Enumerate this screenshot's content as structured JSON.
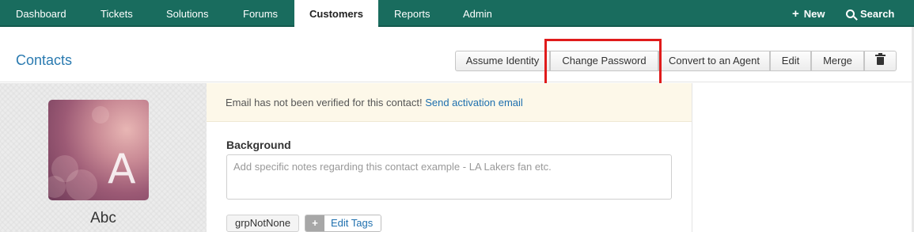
{
  "nav": {
    "items": [
      "Dashboard",
      "Tickets",
      "Solutions",
      "Forums",
      "Customers",
      "Reports",
      "Admin"
    ],
    "active": "Customers",
    "new_label": "New",
    "search_label": "Search"
  },
  "header": {
    "title": "Contacts",
    "buttons": {
      "assume_identity": "Assume Identity",
      "change_password": "Change Password",
      "convert_agent": "Convert to an Agent",
      "edit": "Edit",
      "merge": "Merge"
    }
  },
  "notice": {
    "text": "Email has not been verified for this contact!",
    "link": "Send activation email"
  },
  "contact": {
    "avatar_letter": "A",
    "name": "Abc"
  },
  "background": {
    "label": "Background",
    "placeholder": "Add specific notes regarding this contact example - LA Lakers fan etc."
  },
  "tags": {
    "items": [
      "grpNotNone"
    ],
    "add_symbol": "+",
    "edit_label": "Edit Tags"
  },
  "colors": {
    "nav_bg": "#196c5e",
    "link": "#1e6fae",
    "title": "#2a7ab0",
    "highlight": "#e01b1b",
    "notice_bg": "#fdf8e9"
  }
}
